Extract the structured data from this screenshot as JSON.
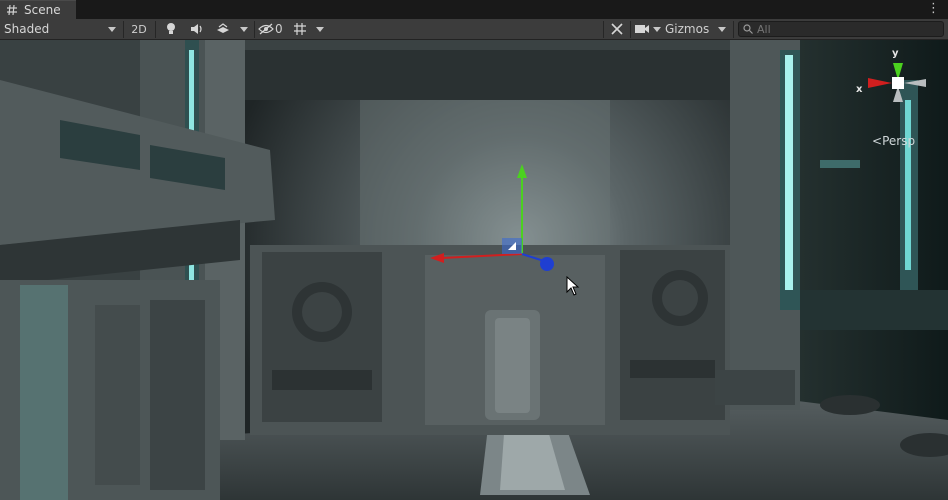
{
  "tab": {
    "title": "Scene"
  },
  "toolbar": {
    "shading_mode": "Shaded",
    "mode_2d_label": "2D",
    "hidden_count": "0",
    "gizmos_label": "Gizmos",
    "search_placeholder": "All"
  },
  "orientation_gizmo": {
    "x_label": "x",
    "y_label": "y",
    "projection_label": "Persp"
  },
  "colors": {
    "x_axis": "#d11f1f",
    "y_axis": "#4bd11f",
    "z_axis": "#1f3fd1"
  }
}
